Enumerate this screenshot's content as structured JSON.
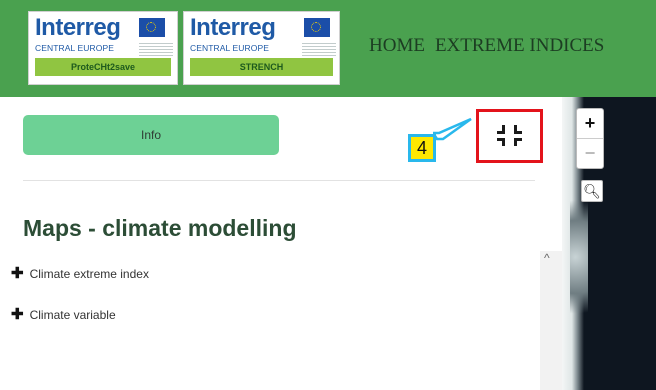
{
  "header": {
    "logos": [
      {
        "brand": "Interreg",
        "region": "CENTRAL EUROPE",
        "project": "ProteCHt2save"
      },
      {
        "brand": "Interreg",
        "region": "CENTRAL EUROPE",
        "project": "STRENCH"
      }
    ],
    "nav": [
      "HOME",
      "EXTREME INDICES"
    ],
    "colors": {
      "header_bg": "#4aa14f",
      "nav_text": "#1c3d22"
    }
  },
  "sidebar": {
    "info_button": "Info",
    "collapse_icon": "collapse-fullscreen-icon",
    "annotation_badge": "4",
    "title": "Maps - climate modelling",
    "accordion": [
      {
        "icon": "plus-icon",
        "label": "Climate extreme index"
      },
      {
        "icon": "plus-icon",
        "label": "Climate variable"
      }
    ],
    "colors": {
      "button_bg": "#6dd195",
      "highlight_border": "#e3131b",
      "badge_bg": "#ffe800",
      "badge_border": "#29b8ec"
    }
  },
  "map": {
    "zoom_in": "+",
    "zoom_out": "−",
    "search_icon": "magnifier-icon"
  }
}
